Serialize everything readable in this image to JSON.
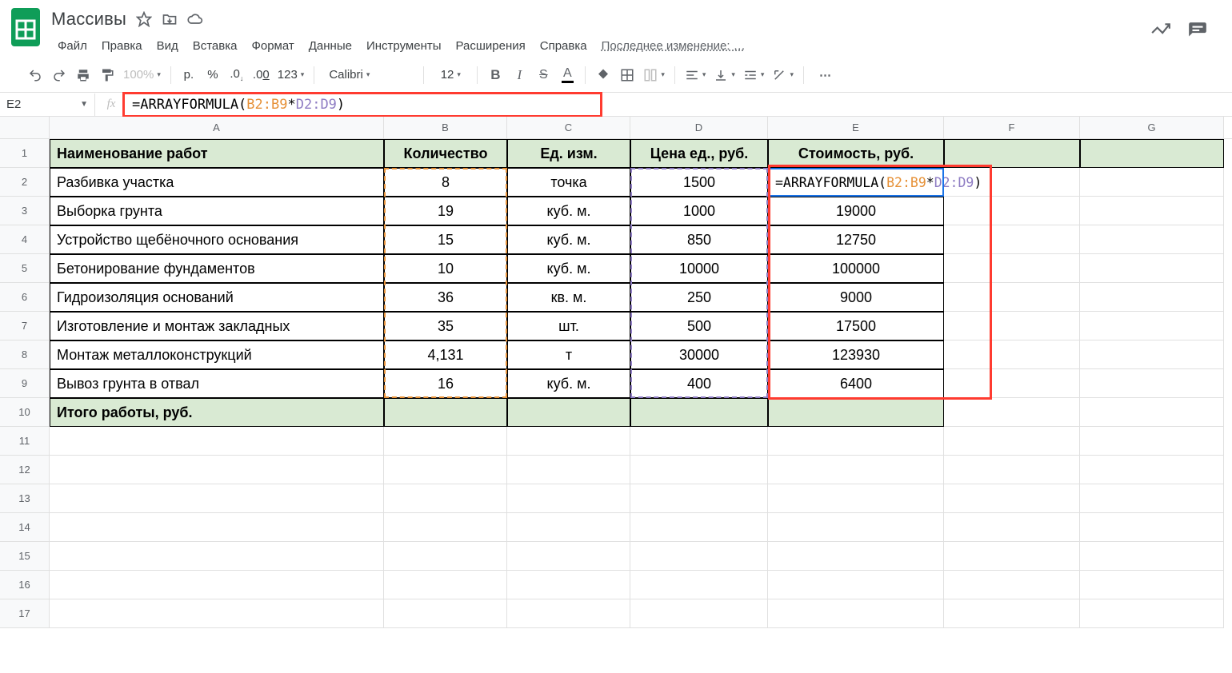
{
  "doc": {
    "title": "Массивы"
  },
  "menu": {
    "file": "Файл",
    "edit": "Правка",
    "view": "Вид",
    "insert": "Вставка",
    "format": "Формат",
    "data": "Данные",
    "tools": "Инструменты",
    "extensions": "Расширения",
    "help": "Справка",
    "last_edit": "Последнее изменение: …"
  },
  "toolbar": {
    "zoom": "100%",
    "currency": "р.",
    "percent": "%",
    "dec_dec": ".0",
    "dec_inc": ".00",
    "num_format": "123",
    "font": "Calibri",
    "size": "12"
  },
  "namebox": "E2",
  "formula": {
    "prefix": "=ARRAYFORMULA(",
    "r1": "B2:B9",
    "op": "*",
    "r2": "D2:D9",
    "suffix": ")"
  },
  "columns": [
    "A",
    "B",
    "C",
    "D",
    "E",
    "F",
    "G"
  ],
  "headers": {
    "a": "Наименование работ",
    "b": "Количество",
    "c": "Ед. изм.",
    "d": "Цена ед., руб.",
    "e": "Стоимость, руб."
  },
  "rows": [
    {
      "a": "Разбивка участка",
      "b": "8",
      "c": "точка",
      "d": "1500",
      "e_formula": true
    },
    {
      "a": "Выборка грунта",
      "b": "19",
      "c": "куб. м.",
      "d": "1000",
      "e": "19000"
    },
    {
      "a": "Устройство щебёночного основания",
      "b": "15",
      "c": "куб. м.",
      "d": "850",
      "e": "12750"
    },
    {
      "a": "Бетонирование фундаментов",
      "b": "10",
      "c": "куб. м.",
      "d": "10000",
      "e": "100000"
    },
    {
      "a": "Гидроизоляция оснований",
      "b": "36",
      "c": "кв. м.",
      "d": "250",
      "e": "9000"
    },
    {
      "a": "Изготовление и монтаж закладных",
      "b": "35",
      "c": "шт.",
      "d": "500",
      "e": "17500"
    },
    {
      "a": "Монтаж металлоконструкций",
      "b": "4,131",
      "c": "т",
      "d": "30000",
      "e": "123930"
    },
    {
      "a": "Вывоз грунта в отвал",
      "b": "16",
      "c": "куб. м.",
      "d": "400",
      "e": "6400"
    }
  ],
  "total_label": "Итого работы, руб.",
  "row_numbers": [
    "1",
    "2",
    "3",
    "4",
    "5",
    "6",
    "7",
    "8",
    "9",
    "10",
    "11",
    "12",
    "13",
    "14",
    "15",
    "16",
    "17"
  ]
}
